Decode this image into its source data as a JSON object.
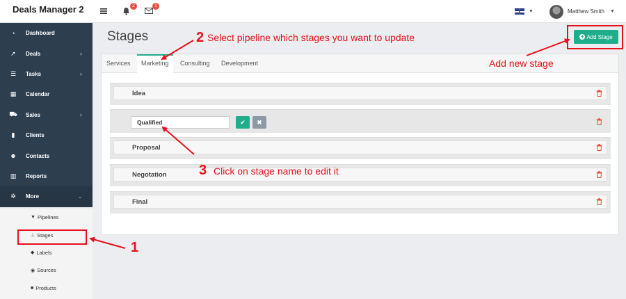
{
  "app": {
    "title": "Deals Manager 2"
  },
  "header": {
    "notifications_count": "2",
    "messages_count": "1",
    "user_name": "Matthew Smith"
  },
  "sidebar": {
    "items": [
      {
        "label": "Dashboard",
        "icon": "dashboard-icon"
      },
      {
        "label": "Deals",
        "icon": "rocket-icon"
      },
      {
        "label": "Tasks",
        "icon": "list-icon"
      },
      {
        "label": "Calendar",
        "icon": "calendar-icon"
      },
      {
        "label": "Sales",
        "icon": "cart-icon"
      },
      {
        "label": "Clients",
        "icon": "building-icon"
      },
      {
        "label": "Contacts",
        "icon": "users-icon"
      },
      {
        "label": "Reports",
        "icon": "bar-chart-icon"
      },
      {
        "label": "More",
        "icon": "gear-icon"
      }
    ],
    "submenu": [
      {
        "label": "Pipelines",
        "icon": "filter-icon"
      },
      {
        "label": "Stages",
        "icon": "sitemap-icon"
      },
      {
        "label": "Labels",
        "icon": "tags-icon"
      },
      {
        "label": "Sources",
        "icon": "eye-icon"
      },
      {
        "label": "Products",
        "icon": "gift-icon"
      }
    ]
  },
  "main": {
    "title": "Stages",
    "add_button": "Add Stage",
    "tabs": [
      "Services",
      "Marketing",
      "Consulting",
      "Development"
    ],
    "active_tab": "Marketing",
    "stages": [
      "Idea",
      "Qualified",
      "Proposal",
      "Negotation",
      "Final"
    ],
    "editing_value": "Qualified"
  },
  "annotations": {
    "step1": "1",
    "step2_num": "2",
    "step2_text": "Select pipeline which stages you want to update",
    "step3_num": "3",
    "step3_text": "Click on stage name to edit it",
    "add_text": "Add new stage"
  },
  "colors": {
    "accent": "#1fae8c",
    "sidebar": "#2d3e4f",
    "annotation": "#e8101a",
    "danger": "#e74c3c"
  }
}
